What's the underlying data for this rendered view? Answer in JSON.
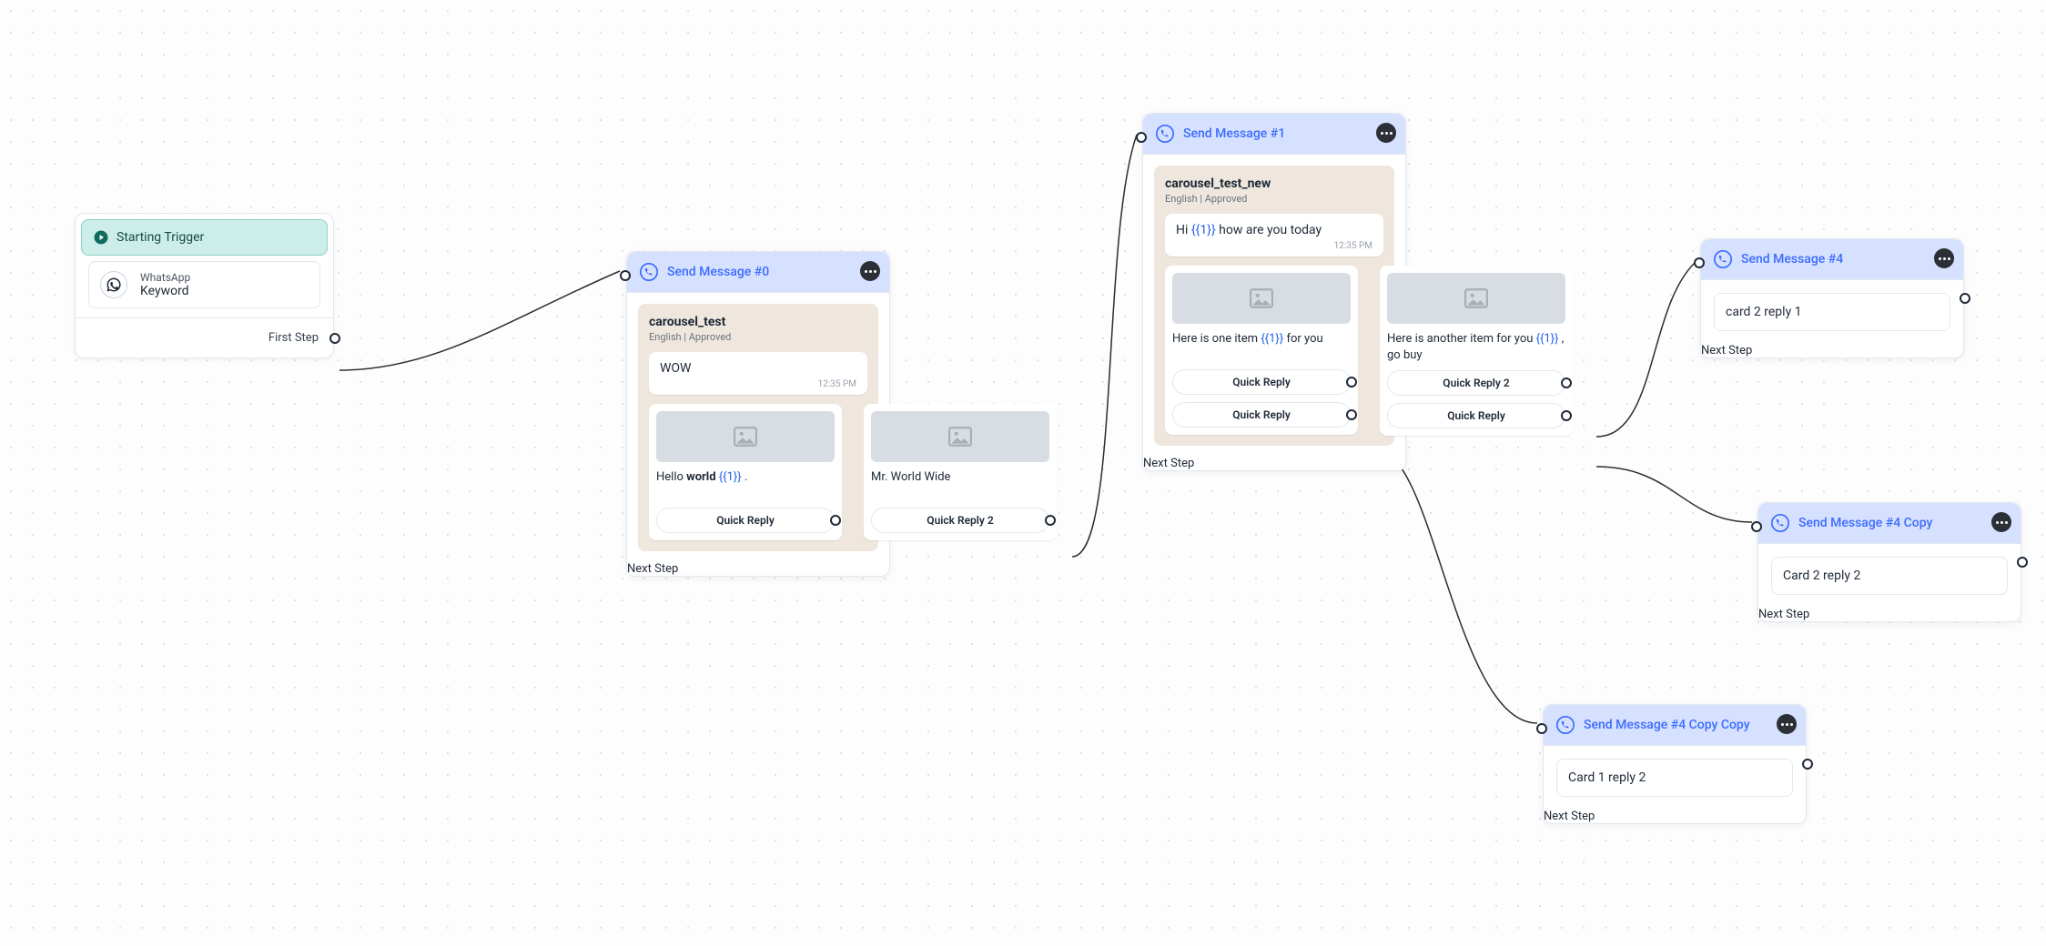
{
  "trigger": {
    "title": "Starting Trigger",
    "channel": "WhatsApp",
    "keyword_label": "Keyword",
    "next": "First Step"
  },
  "send0": {
    "title": "Send Message #0",
    "template": "carousel_test",
    "meta": "English | Approved",
    "bubble_text": "WOW",
    "time": "12:35 PM",
    "card1_prefix": "Hello ",
    "card1_bold": "world ",
    "card1_token": "{{1}}",
    "card1_suffix": " .",
    "card1_qr": "Quick Reply",
    "card2_text": "Mr. World Wide",
    "card2_qr": "Quick Reply 2",
    "next": "Next Step"
  },
  "send1": {
    "title": "Send Message #1",
    "template": "carousel_test_new",
    "meta": "English | Approved",
    "bubble_prefix": "Hi ",
    "bubble_token": "{{1}}",
    "bubble_suffix": " how are you today",
    "time": "12:35 PM",
    "card1_prefix": "Here is one item ",
    "card1_token": "{{1}}",
    "card1_suffix": " for you",
    "card1_qr1": "Quick Reply",
    "card1_qr2": "Quick Reply",
    "card2_prefix": "Here is another item for you ",
    "card2_token": "{{1}}",
    "card2_suffix": " , go buy",
    "card2_qr1": "Quick Reply 2",
    "card2_qr2": "Quick Reply",
    "next": "Next Step"
  },
  "send4": {
    "title": "Send Message #4",
    "msg": "card 2 reply 1",
    "next": "Next Step"
  },
  "send4c": {
    "title": "Send Message #4 Copy",
    "msg": "Card 2 reply 2",
    "next": "Next Step"
  },
  "send4cc": {
    "title": "Send Message #4 Copy Copy",
    "msg": "Card 1 reply 2",
    "next": "Next Step"
  }
}
